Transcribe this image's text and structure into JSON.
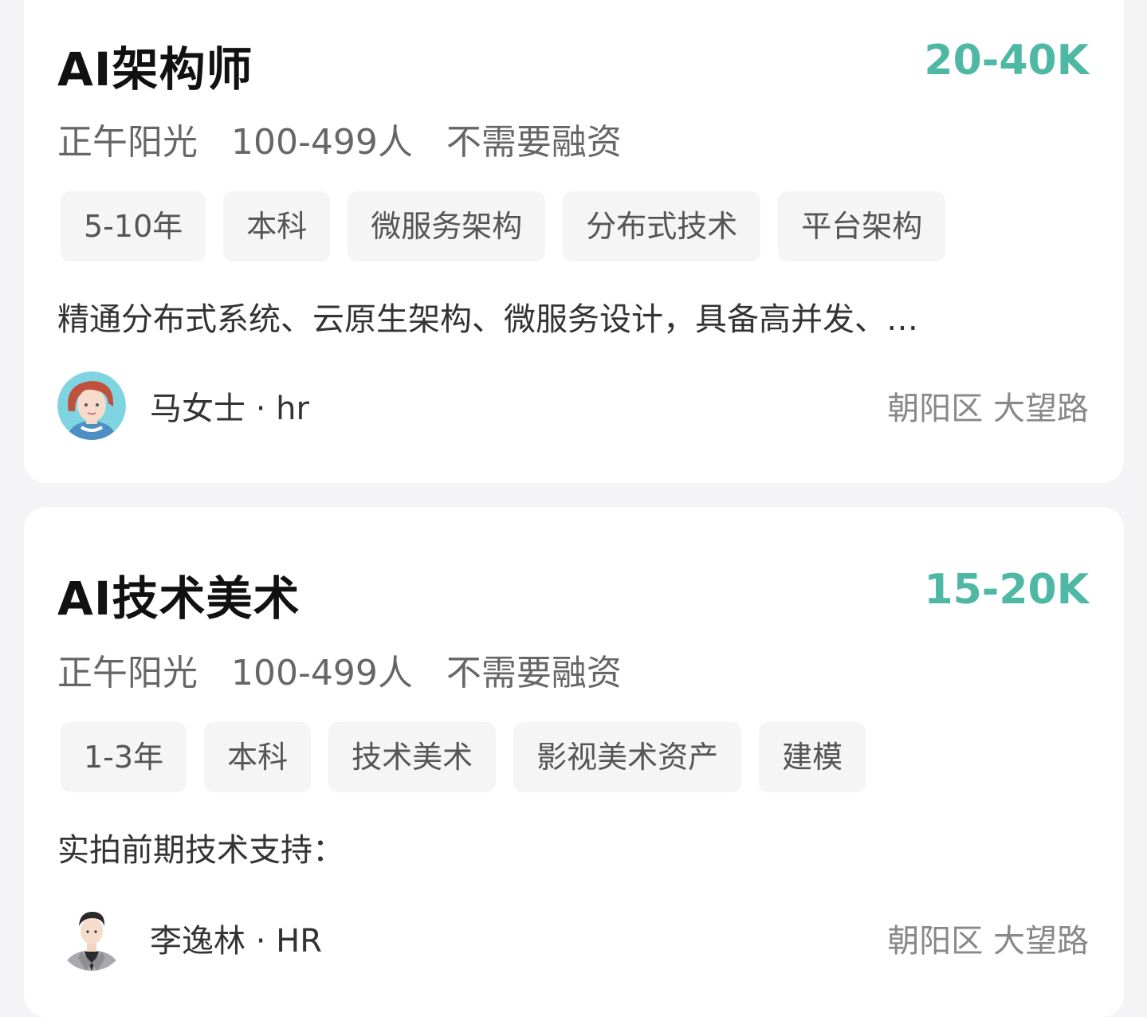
{
  "jobs": [
    {
      "title": "AI架构师",
      "salary": "20-40K",
      "company": "正午阳光",
      "company_size": "100-499人",
      "funding": "不需要融资",
      "tags": [
        "5-10年",
        "本科",
        "微服务架构",
        "分布式技术",
        "平台架构"
      ],
      "description": "精通分布式系统、云原生架构、微服务设计，具备高并发、…",
      "recruiter": "马女士 · hr",
      "avatar_icon": "female-avatar-icon",
      "location": "朝阳区 大望路"
    },
    {
      "title": "AI技术美术",
      "salary": "15-20K",
      "company": "正午阳光",
      "company_size": "100-499人",
      "funding": "不需要融资",
      "tags": [
        "1-3年",
        "本科",
        "技术美术",
        "影视美术资产",
        "建模"
      ],
      "description": "实拍前期技术支持：",
      "recruiter": "李逸林 · HR",
      "avatar_icon": "male-avatar-icon",
      "location": "朝阳区 大望路"
    }
  ],
  "colors": {
    "salary": "#4fb8a5",
    "background": "#f4f4f6",
    "card": "#ffffff",
    "tag_bg": "#f5f5f5"
  }
}
